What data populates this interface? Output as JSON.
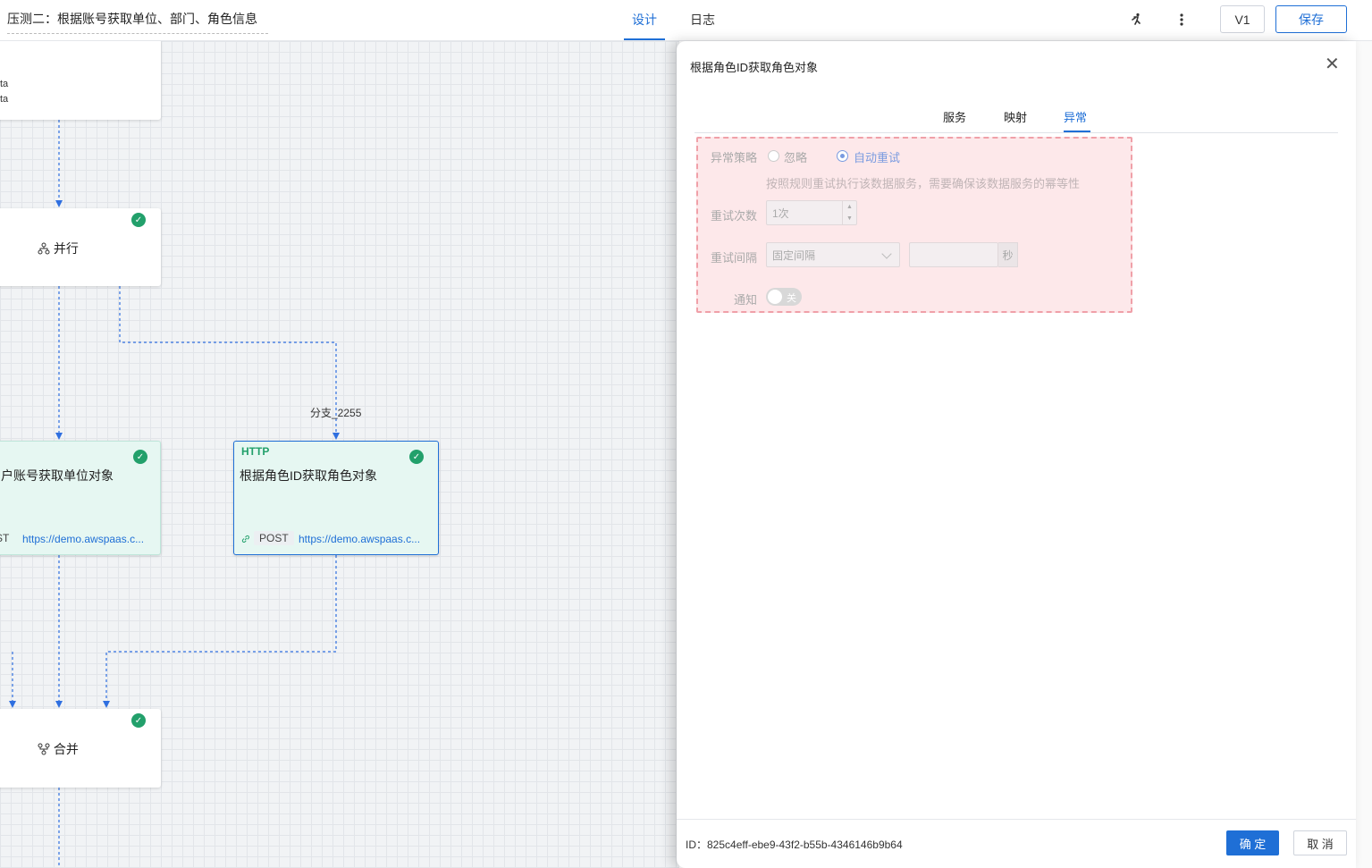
{
  "header": {
    "title": "压测二：根据账号获取单位、部门、角色信息",
    "tabs": [
      {
        "label": "设计",
        "active": true
      },
      {
        "label": "日志",
        "active": false
      }
    ],
    "version_label": "V1",
    "save_label": "保存"
  },
  "canvas": {
    "top_node": {
      "line1": "ta",
      "line2": "ta"
    },
    "parallel_node": {
      "label": "并行"
    },
    "branch_label": "分支_2255",
    "node_left": {
      "label": "户账号获取单位对象",
      "method": "ST",
      "url": "https://demo.awspaas.c..."
    },
    "node_http": {
      "tag": "HTTP",
      "label": "根据角色ID获取角色对象",
      "method": "POST",
      "url": "https://demo.awspaas.c..."
    },
    "merge_node": {
      "label": "合并"
    }
  },
  "drawer": {
    "title": "根据角色ID获取角色对象",
    "tabs": [
      {
        "label": "服务",
        "active": false
      },
      {
        "label": "映射",
        "active": false
      },
      {
        "label": "异常",
        "active": true
      }
    ],
    "exception": {
      "strategy_label": "异常策略",
      "option_ignore": "忽略",
      "option_retry": "自动重试",
      "selected": "自动重试",
      "hint": "按照规则重试执行该数据服务，需要确保该数据服务的幂等性",
      "retry_count_label": "重试次数",
      "retry_count_value": "1次",
      "retry_interval_label": "重试间隔",
      "retry_interval_value": "固定间隔",
      "interval_value": "",
      "interval_unit": "秒",
      "notify_label": "通知",
      "notify_state": "关"
    },
    "footer": {
      "id_text": "ID：825c4eff-ebe9-43f2-b55b-4346146b9b64",
      "ok_label": "确 定",
      "cancel_label": "取 消"
    }
  },
  "colors": {
    "primary": "#1f6fd6",
    "success": "#22a06b",
    "exception_bg": "#fde8ea"
  }
}
